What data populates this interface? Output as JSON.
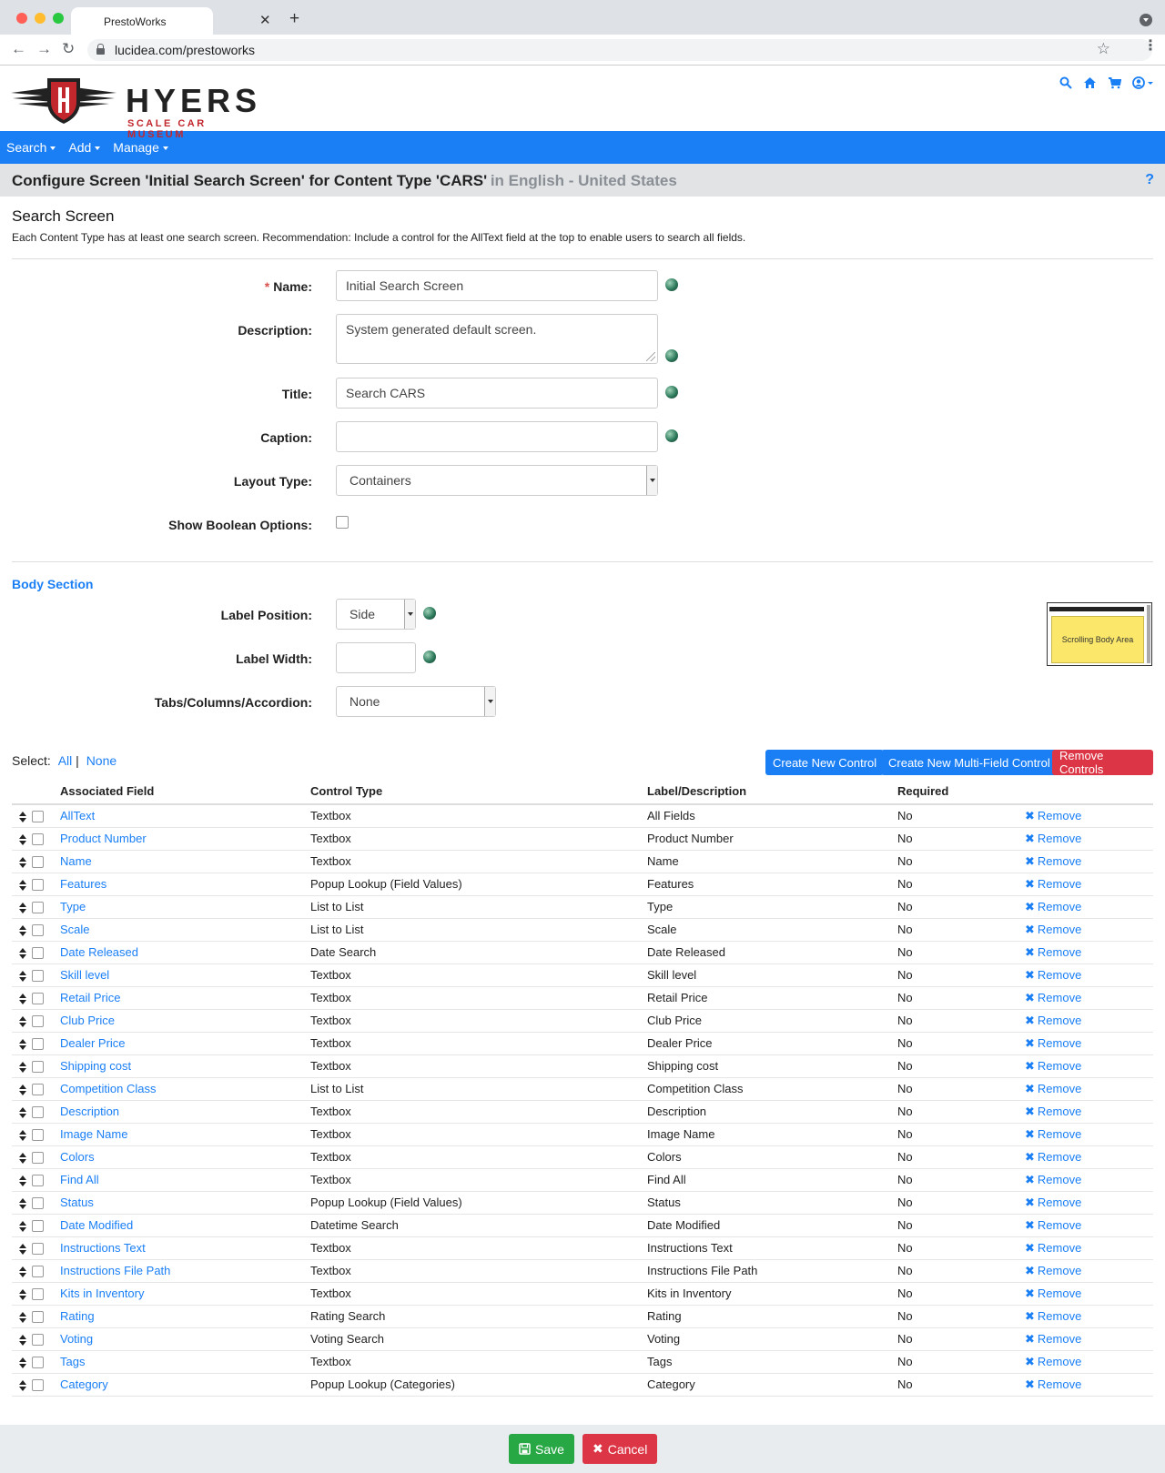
{
  "browser": {
    "tab_title": "PrestoWorks",
    "url": "lucidea.com/prestoworks"
  },
  "site": {
    "logo_name": "HYERS",
    "logo_tagline": "SCALE CAR MUSEUM",
    "header_icons": [
      "search-icon",
      "home-icon",
      "cart-icon",
      "user-icon"
    ]
  },
  "nav": {
    "items": [
      {
        "label": "Search"
      },
      {
        "label": "Add"
      },
      {
        "label": "Manage"
      }
    ]
  },
  "title_bar": {
    "main": "Configure Screen 'Initial Search Screen' for Content Type 'CARS'",
    "sub": "in English - United States",
    "help": "?"
  },
  "search_screen": {
    "heading": "Search Screen",
    "description": "Each Content Type has at least one search screen. Recommendation: Include a control for the AllText field at the top to enable users to search all fields.",
    "fields": {
      "name_label": "Name:",
      "name_required": "*",
      "name_value": "Initial Search Screen",
      "description_label": "Description:",
      "description_value": "System generated default screen.",
      "title_label": "Title:",
      "title_value": "Search CARS",
      "caption_label": "Caption:",
      "caption_value": "",
      "layout_type_label": "Layout Type:",
      "layout_type_value": "Containers",
      "show_boolean_label": "Show Boolean Options:"
    }
  },
  "body_section": {
    "heading": "Body Section",
    "label_position_label": "Label Position:",
    "label_position_value": "Side",
    "label_width_label": "Label Width:",
    "label_width_value": "",
    "tabs_label": "Tabs/Columns/Accordion:",
    "tabs_value": "None",
    "preview_text": "Scrolling Body Area"
  },
  "controls": {
    "select_label": "Select:",
    "select_all": "All",
    "select_separator": "|",
    "select_none": "None",
    "buttons": {
      "create_new": "Create New Control",
      "create_multi": "Create New Multi-Field Control",
      "remove_controls": "Remove Controls"
    },
    "columns": {
      "field": "Associated Field",
      "control": "Control Type",
      "label": "Label/Description",
      "required": "Required"
    },
    "remove_label": "Remove",
    "rows": [
      {
        "field": "AllText",
        "control": "Textbox",
        "label": "All Fields",
        "required": "No"
      },
      {
        "field": "Product Number",
        "control": "Textbox",
        "label": "Product Number",
        "required": "No"
      },
      {
        "field": "Name",
        "control": "Textbox",
        "label": "Name",
        "required": "No"
      },
      {
        "field": "Features",
        "control": "Popup Lookup (Field Values)",
        "label": "Features",
        "required": "No"
      },
      {
        "field": "Type",
        "control": "List to List",
        "label": "Type",
        "required": "No"
      },
      {
        "field": "Scale",
        "control": "List to List",
        "label": "Scale",
        "required": "No"
      },
      {
        "field": "Date Released",
        "control": "Date Search",
        "label": "Date Released",
        "required": "No"
      },
      {
        "field": "Skill level",
        "control": "Textbox",
        "label": "Skill level",
        "required": "No"
      },
      {
        "field": "Retail Price",
        "control": "Textbox",
        "label": "Retail Price",
        "required": "No"
      },
      {
        "field": "Club Price",
        "control": "Textbox",
        "label": "Club Price",
        "required": "No"
      },
      {
        "field": "Dealer Price",
        "control": "Textbox",
        "label": "Dealer Price",
        "required": "No"
      },
      {
        "field": "Shipping cost",
        "control": "Textbox",
        "label": "Shipping cost",
        "required": "No"
      },
      {
        "field": "Competition Class",
        "control": "List to List",
        "label": "Competition Class",
        "required": "No"
      },
      {
        "field": "Description",
        "control": "Textbox",
        "label": "Description",
        "required": "No"
      },
      {
        "field": "Image Name",
        "control": "Textbox",
        "label": "Image Name",
        "required": "No"
      },
      {
        "field": "Colors",
        "control": "Textbox",
        "label": "Colors",
        "required": "No"
      },
      {
        "field": "Find All",
        "control": "Textbox",
        "label": "Find All",
        "required": "No"
      },
      {
        "field": "Status",
        "control": "Popup Lookup (Field Values)",
        "label": "Status",
        "required": "No"
      },
      {
        "field": "Date Modified",
        "control": "Datetime Search",
        "label": "Date Modified",
        "required": "No"
      },
      {
        "field": "Instructions Text",
        "control": "Textbox",
        "label": "Instructions Text",
        "required": "No"
      },
      {
        "field": "Instructions File Path",
        "control": "Textbox",
        "label": "Instructions File Path",
        "required": "No"
      },
      {
        "field": "Kits in Inventory",
        "control": "Textbox",
        "label": "Kits in Inventory",
        "required": "No"
      },
      {
        "field": "Rating",
        "control": "Rating Search",
        "label": "Rating",
        "required": "No"
      },
      {
        "field": "Voting",
        "control": "Voting Search",
        "label": "Voting",
        "required": "No"
      },
      {
        "field": "Tags",
        "control": "Textbox",
        "label": "Tags",
        "required": "No"
      },
      {
        "field": "Category",
        "control": "Popup Lookup (Categories)",
        "label": "Category",
        "required": "No"
      }
    ]
  },
  "footer": {
    "save": "Save",
    "cancel": "Cancel"
  }
}
